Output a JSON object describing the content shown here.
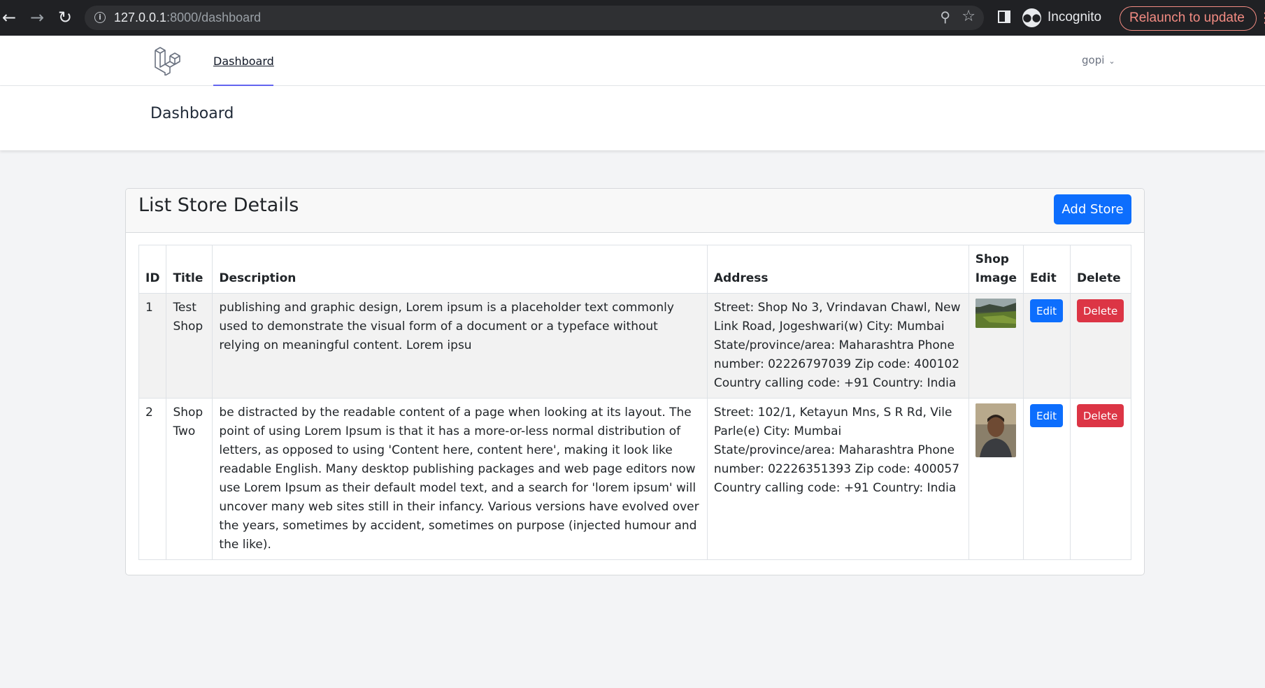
{
  "browser": {
    "url_host": "127.0.0.1",
    "url_path": ":8000/dashboard",
    "profile_label": "Incognito",
    "relaunch_label": "Relaunch to update"
  },
  "nav": {
    "link_dashboard": "Dashboard",
    "user_name": "gopi"
  },
  "header": {
    "title": "Dashboard"
  },
  "card": {
    "title": "List Store Details",
    "add_button": "Add Store"
  },
  "table": {
    "headers": [
      "ID",
      "Title",
      "Description",
      "Address",
      "Shop Image",
      "Edit",
      "Delete"
    ],
    "rows": [
      {
        "id": "1",
        "title": "Test Shop",
        "description": "publishing and graphic design, Lorem ipsum is a placeholder text commonly used to demonstrate the visual form of a document or a typeface without relying on meaningful content. Lorem ipsu",
        "address": "Street: Shop No 3, Vrindavan Chawl, New Link Road, Jogeshwari(w) City: Mumbai State/province/area: Maharashtra Phone number: 02226797039 Zip code: 400102 Country calling code: +91 Country: India",
        "edit_label": "Edit",
        "delete_label": "Delete"
      },
      {
        "id": "2",
        "title": "Shop Two",
        "description": "be distracted by the readable content of a page when looking at its layout. The point of using Lorem Ipsum is that it has a more-or-less normal distribution of letters, as opposed to using 'Content here, content here', making it look like readable English. Many desktop publishing packages and web page editors now use Lorem Ipsum as their default model text, and a search for 'lorem ipsum' will uncover many web sites still in their infancy. Various versions have evolved over the years, sometimes by accident, sometimes on purpose (injected humour and the like).",
        "address": "Street: 102/1, Ketayun Mns, S R Rd, Vile Parle(e) City: Mumbai State/province/area: Maharashtra Phone number: 02226351393 Zip code: 400057 Country calling code: +91 Country: India",
        "edit_label": "Edit",
        "delete_label": "Delete"
      }
    ]
  },
  "colors": {
    "primary": "#0d6efd",
    "danger": "#dc3545",
    "nav_active": "#6366f1"
  }
}
